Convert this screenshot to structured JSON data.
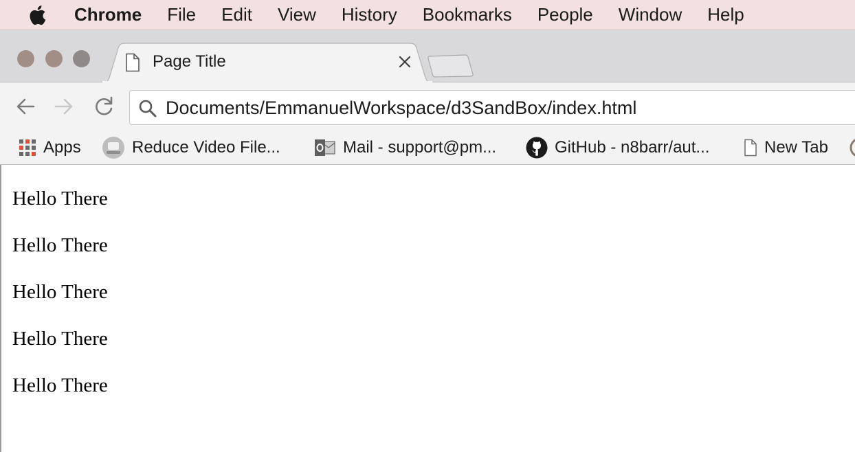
{
  "menubar": {
    "app_name": "Chrome",
    "items": [
      "File",
      "Edit",
      "View",
      "History",
      "Bookmarks",
      "People",
      "Window",
      "Help"
    ]
  },
  "tab": {
    "title": "Page Title"
  },
  "omnibox": {
    "url": "Documents/EmmanuelWorkspace/d3SandBox/index.html"
  },
  "bookmarks": {
    "items": [
      {
        "label": "Apps",
        "icon": "apps-grid-icon"
      },
      {
        "label": "Reduce Video File...",
        "icon": "video-site-icon"
      },
      {
        "label": "Mail - support@pm...",
        "icon": "outlook-icon"
      },
      {
        "label": "GitHub - n8barr/aut...",
        "icon": "github-icon"
      },
      {
        "label": "New Tab",
        "icon": "page-icon"
      }
    ]
  },
  "page": {
    "paragraphs": [
      "Hello There",
      "Hello There",
      "Hello There",
      "Hello There",
      "Hello There"
    ]
  },
  "colors": {
    "menubar_bg": "#f3e1e2",
    "tabstrip_bg": "#d9d8da",
    "toolbar_bg": "#f3f3f3",
    "traffic_light": "#a18f87"
  }
}
